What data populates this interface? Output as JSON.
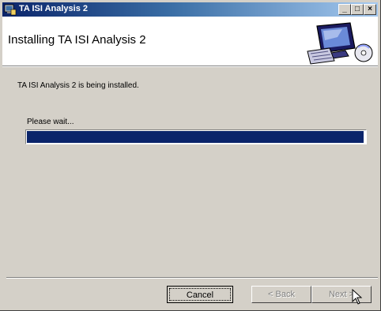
{
  "window": {
    "title": "TA ISI Analysis 2",
    "controls": {
      "minimize": "_",
      "maximize": "□",
      "close": "×"
    }
  },
  "header": {
    "title": "Installing TA ISI Analysis 2",
    "art_icon": "computer-cd-icon"
  },
  "body": {
    "status": "TA ISI Analysis 2 is being installed.",
    "wait": "Please wait...",
    "progress": 0.995
  },
  "buttons": {
    "cancel": "Cancel",
    "back": "< Back",
    "next": "Next >"
  },
  "colors": {
    "progress_fill": "#0a246a",
    "window_bg": "#d4d0c8",
    "title_gradient_start": "#0a246a",
    "title_gradient_end": "#a6caf0"
  }
}
